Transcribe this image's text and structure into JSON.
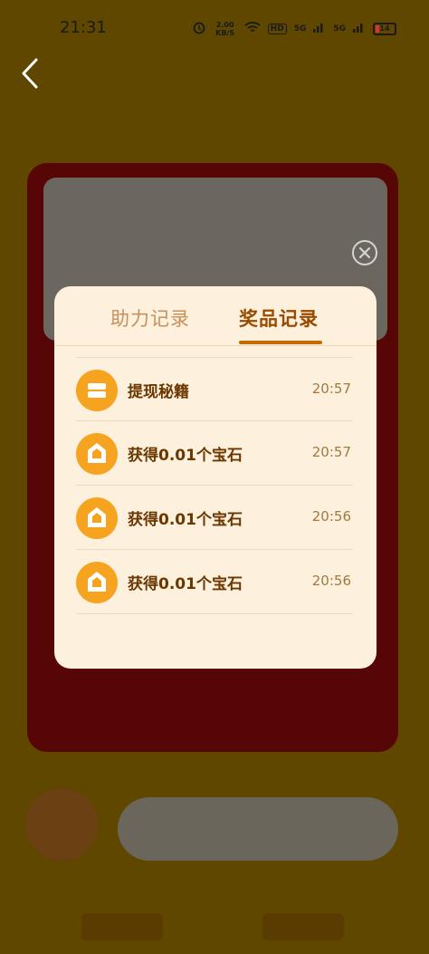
{
  "status_bar": {
    "time": "21:31",
    "speed": "2.00 KB/S",
    "signal_1": "5G",
    "signal_2": "5G",
    "hd_label": "HD",
    "battery": "14"
  },
  "modal": {
    "tabs": [
      {
        "label": "助力记录",
        "active": false
      },
      {
        "label": "奖品记录",
        "active": true
      }
    ],
    "records": [
      {
        "icon": "cash-coupon-icon",
        "label": "提现秘籍",
        "time": "20:57"
      },
      {
        "icon": "gem-icon",
        "label": "获得0.01个宝石",
        "time": "20:57"
      },
      {
        "icon": "gem-icon",
        "label": "获得0.01个宝石",
        "time": "20:56"
      },
      {
        "icon": "gem-icon",
        "label": "获得0.01个宝石",
        "time": "20:56"
      }
    ]
  },
  "colors": {
    "modal_bg": "#fdf0dd",
    "active_tab": "#9a4b00",
    "inactive_tab": "#c8905a",
    "icon_orange": "#f6a31f",
    "overlay": "rgba(0,0,0,0.58)"
  }
}
